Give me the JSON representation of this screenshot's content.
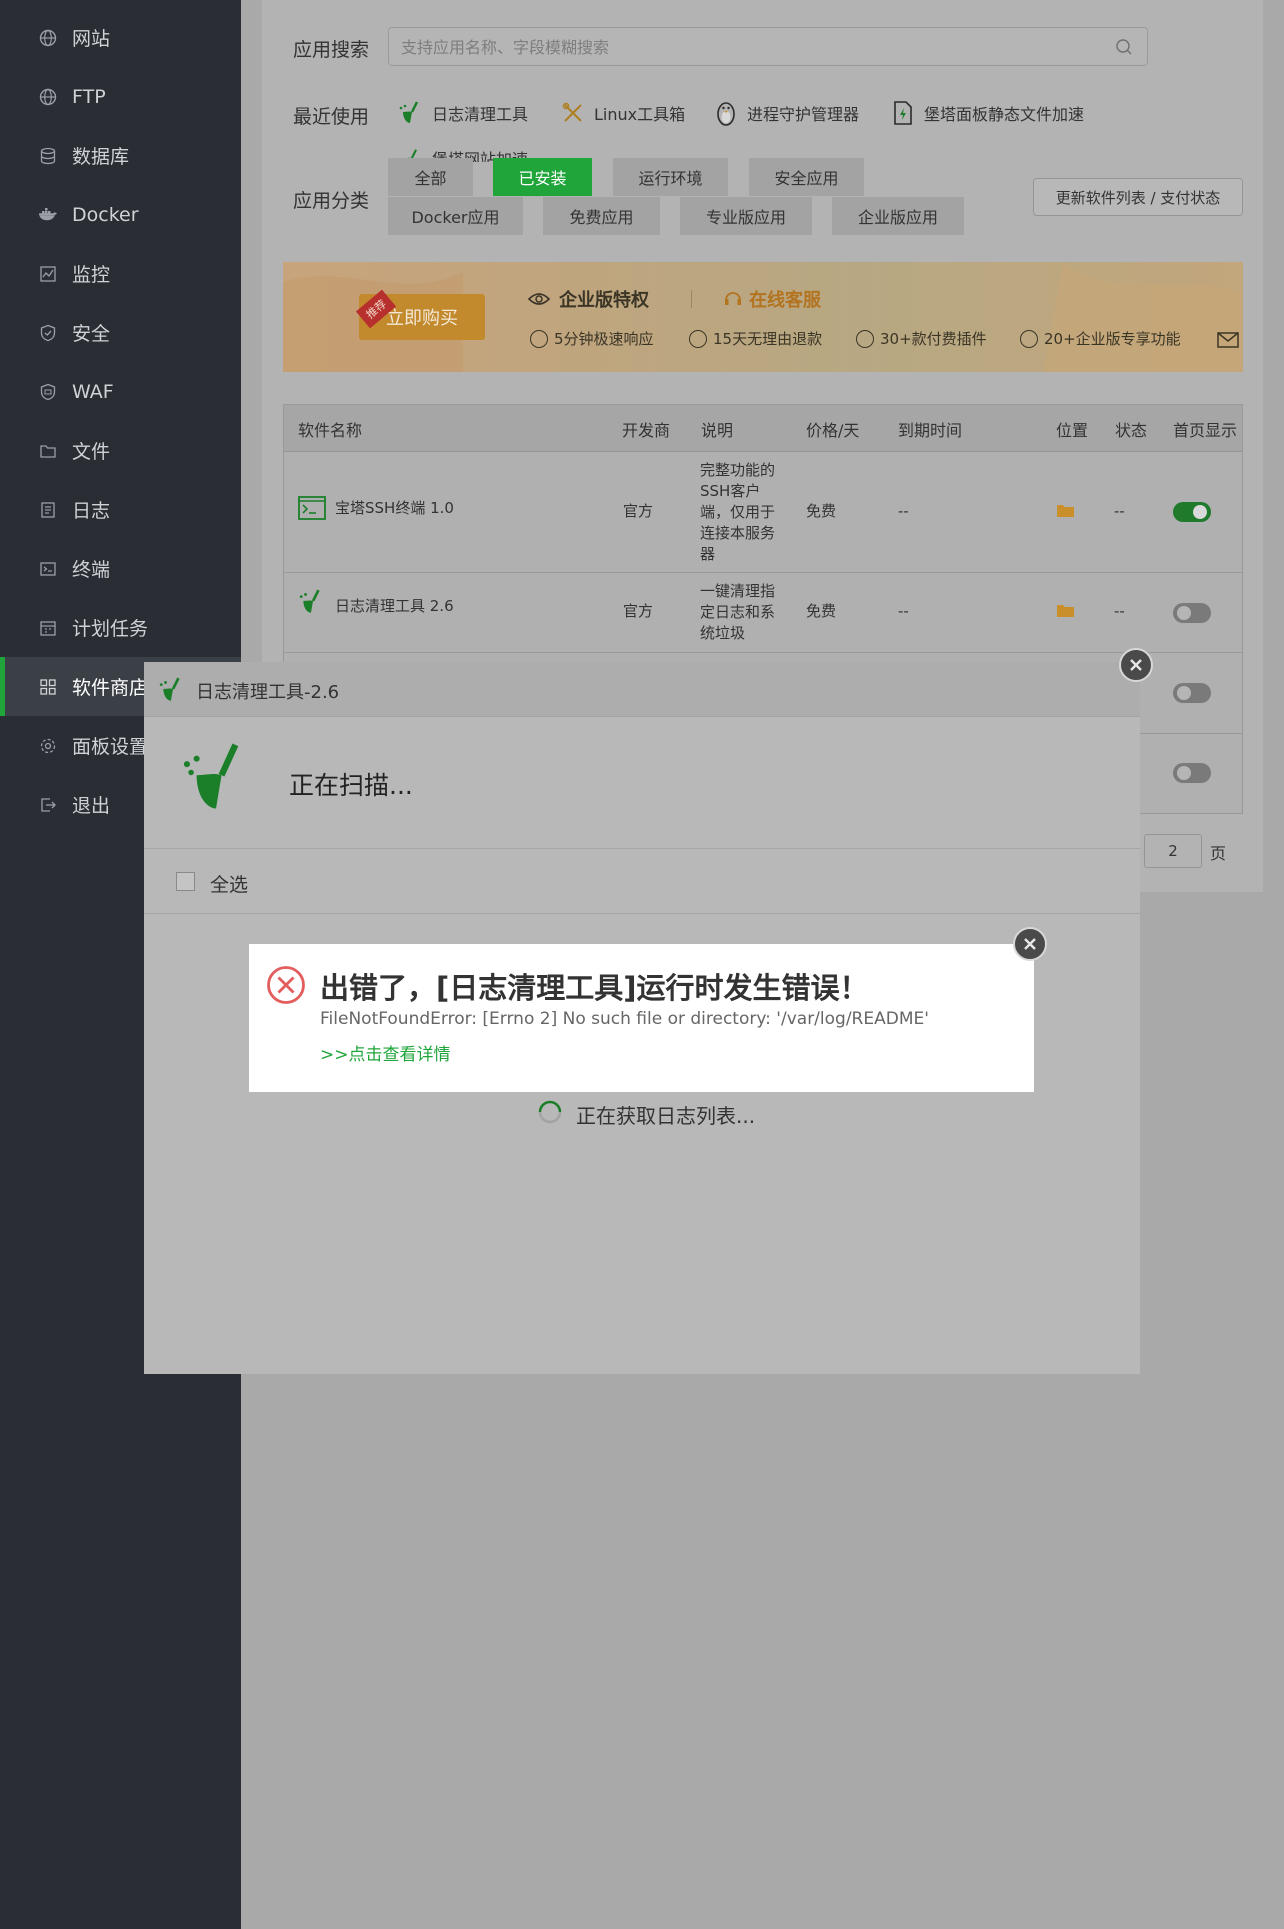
{
  "sidebar": {
    "items": [
      {
        "label": "网站",
        "icon": "globe-icon"
      },
      {
        "label": "FTP",
        "icon": "ftp-globe-icon"
      },
      {
        "label": "数据库",
        "icon": "database-icon"
      },
      {
        "label": "Docker",
        "icon": "docker-icon"
      },
      {
        "label": "监控",
        "icon": "monitor-icon"
      },
      {
        "label": "安全",
        "icon": "shield-icon"
      },
      {
        "label": "WAF",
        "icon": "waf-shield-icon"
      },
      {
        "label": "文件",
        "icon": "folder-icon"
      },
      {
        "label": "日志",
        "icon": "log-icon"
      },
      {
        "label": "终端",
        "icon": "terminal-icon"
      },
      {
        "label": "计划任务",
        "icon": "calendar-icon"
      },
      {
        "label": "软件商店",
        "icon": "grid-icon"
      },
      {
        "label": "面板设置",
        "icon": "gear-icon"
      },
      {
        "label": "退出",
        "icon": "logout-icon"
      }
    ]
  },
  "search": {
    "label": "应用搜索",
    "placeholder": "支持应用名称、字段模糊搜索"
  },
  "recent": {
    "label": "最近使用",
    "items": [
      "日志清理工具",
      "Linux工具箱",
      "进程守护管理器",
      "堡塔面板静态文件加速",
      "堡塔网站加速"
    ]
  },
  "categories": {
    "label": "应用分类",
    "items": [
      "全部",
      "已安装",
      "运行环境",
      "安全应用",
      "Docker应用",
      "免费应用",
      "专业版应用",
      "企业版应用"
    ],
    "update_label": "更新软件列表 / 支付状态"
  },
  "banner": {
    "tag": "推荐",
    "buy": "立即购买",
    "title": "企业版特权",
    "service": "在线客服",
    "features": [
      "5分钟极速响应",
      "15天无理由退款",
      "30+款付费插件",
      "20+企业版专享功能"
    ]
  },
  "table": {
    "headers": [
      "软件名称",
      "开发商",
      "说明",
      "价格/天",
      "到期时间",
      "位置",
      "状态",
      "首页显示"
    ],
    "rows": [
      {
        "name": "宝塔SSH终端 1.0",
        "dev": "官方",
        "desc": "完整功能的SSH客户端，仅用于连接本服务器",
        "desc_lines": [
          "完整功能的",
          "SSH客户",
          "端，仅用于",
          "连接本服务",
          "器"
        ],
        "price": "免费",
        "expire": "--",
        "status": "--",
        "home": true
      },
      {
        "name": "日志清理工具 2.6",
        "dev": "官方",
        "desc": "一键清理指定日志和系统垃圾",
        "desc_lines": [
          "一键清理指",
          "定日志和系",
          "统垃圾"
        ],
        "price": "免费",
        "expire": "--",
        "status": "--",
        "home": false
      }
    ],
    "extra_toggles": [
      false,
      false
    ]
  },
  "pager": {
    "page": "2",
    "unit": "页"
  },
  "dialog": {
    "title": "日志清理工具-2.6",
    "scanning": "正在扫描...",
    "select_all": "全选",
    "loading": "正在获取日志列表..."
  },
  "error": {
    "title": "出错了，[日志清理工具]运行时发生错误！",
    "message": "FileNotFoundError: [Errno 2] No such file or directory: '/var/log/README'",
    "detail_link": ">>点击查看详情"
  },
  "colors": {
    "accent": "#20a53a",
    "error": "#e35d5d",
    "sidebar": "#2a2d34"
  }
}
